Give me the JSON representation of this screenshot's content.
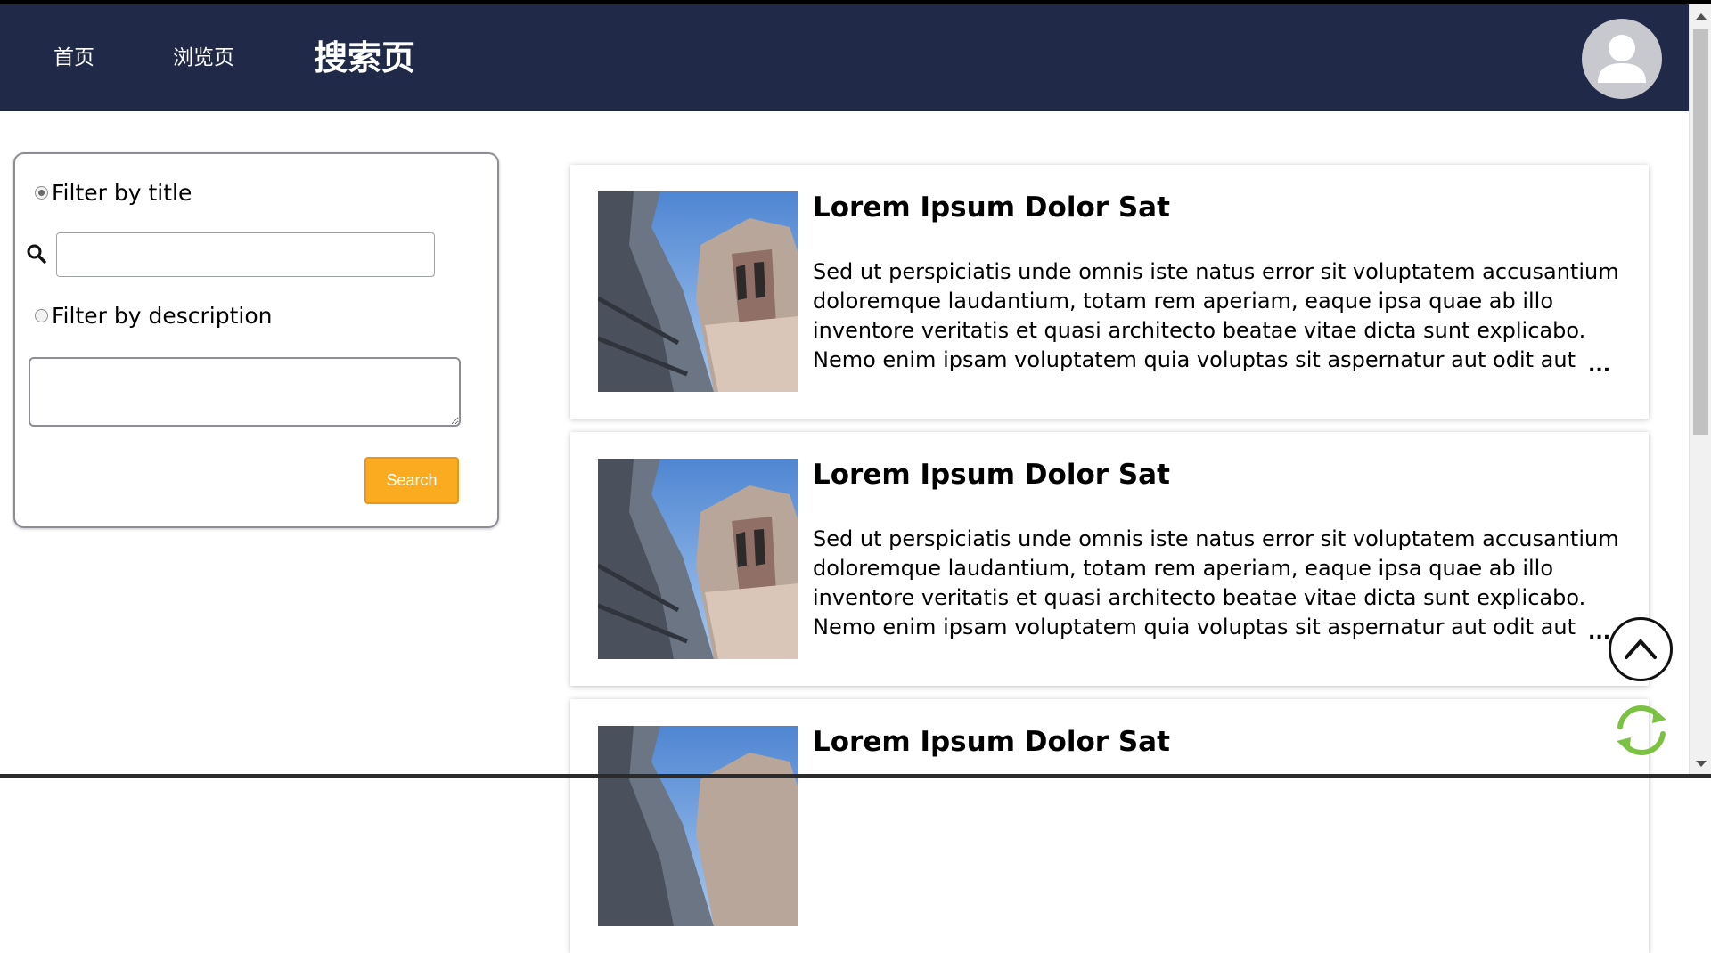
{
  "nav": {
    "home_label": "首页",
    "browse_label": "浏览页",
    "search_label": "搜索页"
  },
  "avatar": {
    "icon": "user-avatar-icon"
  },
  "filter": {
    "title_option_label": "Filter by title",
    "title_option_checked": true,
    "title_input_value": "",
    "description_option_label": "Filter by description",
    "description_option_checked": false,
    "description_value": "",
    "search_button_label": "Search",
    "search_icon": "magnifier-icon"
  },
  "cards": [
    {
      "title": "Lorem Ipsum Dolor Sat",
      "description": "Sed ut perspiciatis unde omnis iste natus error sit voluptatem accusantium doloremque laudantium, totam rem aperiam, eaque ipsa quae ab illo inventore veritatis et quasi architecto beatae vitae dicta sunt explicabo. Nemo enim ipsam voluptatem quia voluptas sit aspernatur aut odit aut fugit, sed quia",
      "more_label": "..."
    },
    {
      "title": "Lorem Ipsum Dolor Sat",
      "description": "Sed ut perspiciatis unde omnis iste natus error sit voluptatem accusantium doloremque laudantium, totam rem aperiam, eaque ipsa quae ab illo inventore veritatis et quasi architecto beatae vitae dicta sunt explicabo. Nemo enim ipsam voluptatem quia voluptas sit aspernatur aut odit aut fugit, sed quia",
      "more_label": "..."
    },
    {
      "title": "Lorem Ipsum Dolor Sat",
      "description": "",
      "more_label": ""
    }
  ],
  "floating": {
    "back_to_top_icon": "chevron-up-icon",
    "refresh_icon": "refresh-icon"
  },
  "colors": {
    "header_bg": "#202a48",
    "search_button": "#fbab20",
    "refresh_icon": "#7cc242"
  }
}
